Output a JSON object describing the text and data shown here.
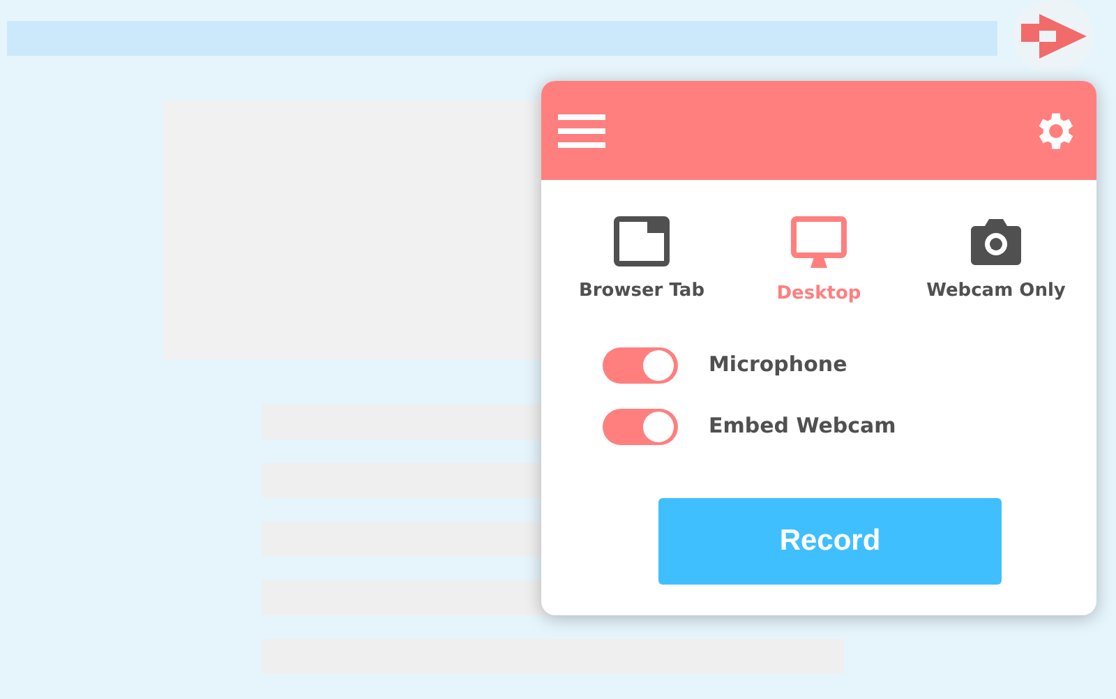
{
  "modes": [
    {
      "kind": "tab",
      "label": "Browser Tab",
      "selected": false
    },
    {
      "kind": "desktop",
      "label": "Desktop",
      "selected": true
    },
    {
      "kind": "webcam",
      "label": "Webcam Only",
      "selected": false
    }
  ],
  "toggles": [
    {
      "label": "Microphone",
      "on": true
    },
    {
      "label": "Embed Webcam",
      "on": true
    }
  ],
  "record_button": "Record"
}
